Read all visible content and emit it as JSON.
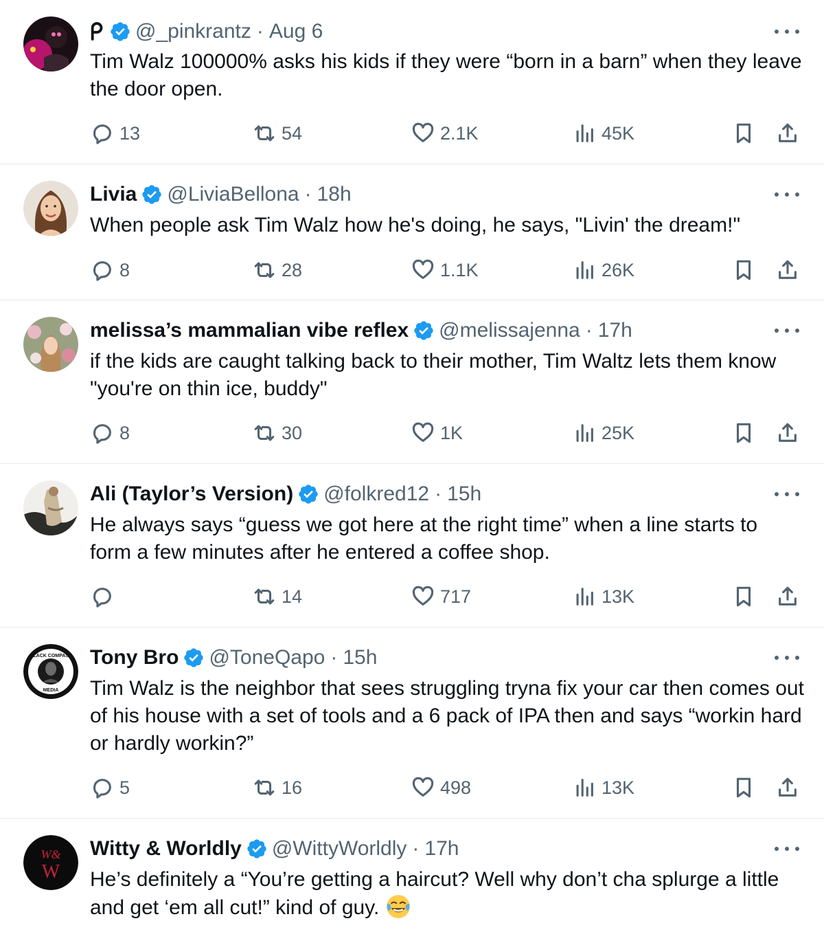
{
  "colors": {
    "verified": "#1d9bf0",
    "secondary_text": "#536471",
    "primary_text": "#0f1419",
    "divider": "#e6e9ec"
  },
  "tweets": [
    {
      "name": "",
      "name_logo": "p-logo",
      "handle": "@_pinkrantz",
      "separator": "·",
      "time": "Aug 6",
      "text": "Tim Walz 100000% asks his kids if they were “born in a barn” when they leave the door open.",
      "replies": "13",
      "retweets": "54",
      "likes": "2.1K",
      "views": "45K"
    },
    {
      "name": "Livia",
      "handle": "@LiviaBellona",
      "separator": "·",
      "time": "18h",
      "text": "When people ask Tim Walz how he's doing, he says, \"Livin' the dream!\"",
      "replies": "8",
      "retweets": "28",
      "likes": "1.1K",
      "views": "26K"
    },
    {
      "name": "melissa’s mammalian vibe reflex",
      "handle": "@melissajenna",
      "separator": "·",
      "time": "17h",
      "text": "if the kids are caught talking back to their mother, Tim Waltz lets them know \"you're on thin ice, buddy\"",
      "replies": "8",
      "retweets": "30",
      "likes": "1K",
      "views": "25K"
    },
    {
      "name": "Ali (Taylor’s Version)",
      "handle": "@folkred12",
      "separator": "·",
      "time": "15h",
      "text": "He always says “guess we got here at the right time” when a line starts to form a few minutes after he entered a coffee shop.",
      "replies": "",
      "retweets": "14",
      "likes": "717",
      "views": "13K"
    },
    {
      "name": "Tony Bro",
      "handle": "@ToneQapo",
      "separator": "·",
      "time": "15h",
      "avatar_text_top": "BLACK COMPASS",
      "avatar_text_bottom": "MEDIA",
      "text": "Tim Walz is the neighbor that sees struggling tryna fix your car then comes out of his house with a set of tools and a 6 pack of IPA then and says “workin hard or hardly workin?”",
      "replies": "5",
      "retweets": "16",
      "likes": "498",
      "views": "13K"
    },
    {
      "name": "Witty & Worldly",
      "handle": "@WittyWorldly",
      "separator": "·",
      "time": "17h",
      "avatar_text_top": "W&",
      "avatar_text_bottom": "W",
      "text": "He’s definitely a “You’re getting a haircut? Well why don’t cha splurge a little and get ‘em all cut!” kind of guy.",
      "emoji": "face-with-tears-of-joy"
    }
  ]
}
